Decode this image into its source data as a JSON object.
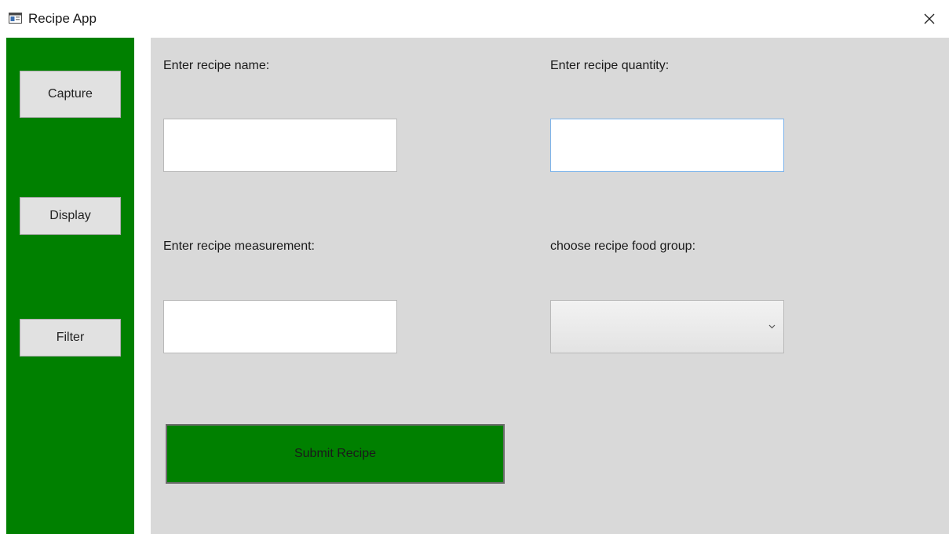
{
  "window": {
    "title": "Recipe App"
  },
  "sidebar": {
    "items": [
      {
        "label": "Capture"
      },
      {
        "label": "Display"
      },
      {
        "label": "Filter"
      }
    ]
  },
  "form": {
    "name_label": "Enter recipe name:",
    "name_value": "",
    "quantity_label": "Enter recipe quantity:",
    "quantity_value": "",
    "measurement_label": "Enter recipe measurement:",
    "measurement_value": "",
    "food_group_label": "choose recipe food group:",
    "food_group_value": "",
    "submit_label": "Submit Recipe"
  },
  "colors": {
    "accent": "#008000",
    "panel": "#d9d9d9",
    "focus_border": "#7eb4ea"
  }
}
